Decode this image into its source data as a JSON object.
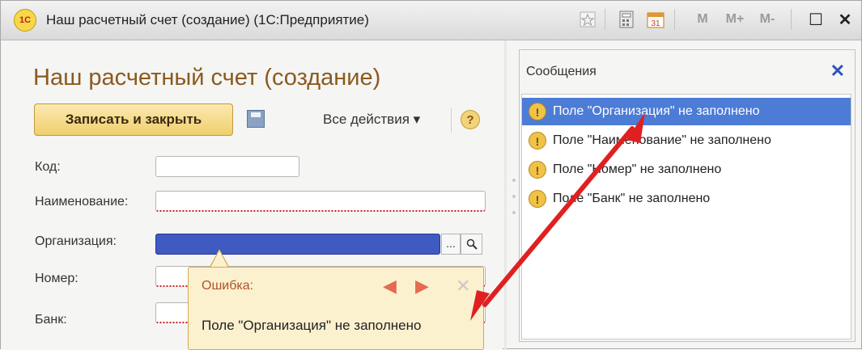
{
  "window": {
    "title": "Наш расчетный счет (создание)  (1С:Предприятие)",
    "logo_text": "1С",
    "toolbar_icons": [
      "star-icon",
      "calculator-icon",
      "calendar-icon"
    ],
    "calendar_day": "31",
    "memory_buttons": [
      "M",
      "M+",
      "M-"
    ],
    "maximize_glyph": "☐",
    "close_glyph": "✕"
  },
  "form": {
    "title": "Наш расчетный счет (создание)",
    "save_close_label": "Записать и закрыть",
    "all_actions_label": "Все действия ▾",
    "help_glyph": "?",
    "fields": {
      "code": {
        "label": "Код:",
        "value": ""
      },
      "name": {
        "label": "Наименование:",
        "value": ""
      },
      "org": {
        "label": "Организация:",
        "value": "",
        "btn_dots": "...",
        "btn_search": "🔍"
      },
      "number": {
        "label": "Номер:",
        "value": ""
      },
      "bank": {
        "label": "Банк:",
        "value": ""
      }
    }
  },
  "tooltip": {
    "header": "Ошибка:",
    "prev": "◀",
    "next": "▶",
    "close": "✕",
    "text": "Поле \"Организация\" не заполнено"
  },
  "messages": {
    "title": "Сообщения",
    "close_glyph": "✕",
    "items": [
      "Поле \"Организация\" не заполнено",
      "Поле \"Наименование\" не заполнено",
      "Поле \"Номер\" не заполнено",
      "Поле \"Банк\" не заполнено"
    ],
    "warn_glyph": "!"
  },
  "colors": {
    "arrow": "#e02020",
    "selection": "#4d7cd6"
  }
}
